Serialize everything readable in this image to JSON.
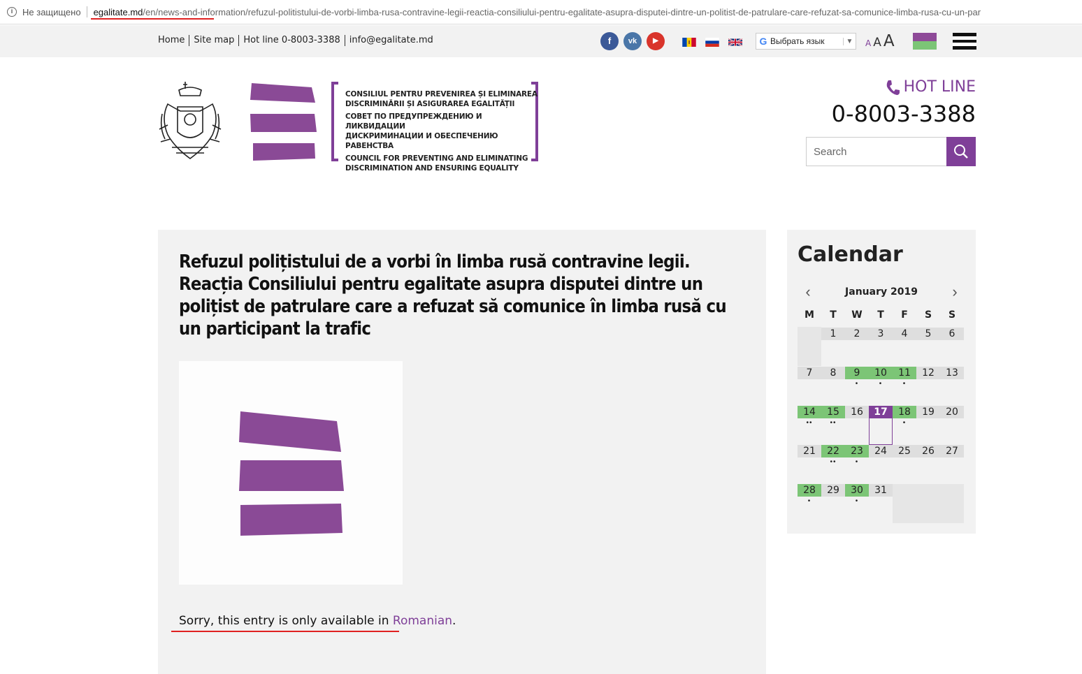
{
  "browser": {
    "security_label": "Не защищено",
    "url_host": "egalitate.md",
    "url_path": "/en/news-and-information/refuzul-politistului-de-vorbi-limba-rusa-contravine-legii-reactia-consiliului-pentru-egalitate-asupra-disputei-dintre-un-politist-de-patrulare-care-refuzat-sa-comunice-limba-rusa-cu-un-par"
  },
  "topbar": {
    "links": [
      "Home",
      "Site map",
      "Hot line 0-8003-3388",
      "info@egalitate.md"
    ],
    "social": [
      {
        "icon": "facebook-icon",
        "glyph": "f",
        "color": "#3b5998"
      },
      {
        "icon": "vk-icon",
        "glyph": "vk",
        "color": "#4a76a8"
      },
      {
        "icon": "youtube-icon",
        "glyph": "▶",
        "color": "#d9342b"
      }
    ],
    "translate_label": "Выбрать язык",
    "font_sizes": [
      "A",
      "A",
      "A"
    ]
  },
  "header": {
    "logo_lines": [
      "CONSILIUL PENTRU PREVENIREA ȘI ELIMINAREA",
      "DISCRIMINĂRII ȘI ASIGURAREA EGALITĂȚII",
      "СОВЕТ ПО ПРЕДУПРЕЖДЕНИЮ И ЛИКВИДАЦИИ",
      "ДИСКРИМИНАЦИИ И ОБЕСПЕЧЕНИЮ РАВЕНСТВА",
      "COUNCIL FOR PREVENTING AND ELIMINATING",
      "DISCRIMINATION AND ENSURING EQUALITY"
    ],
    "hotline_label": "HOT LINE",
    "hotline_number": "0-8003-3388",
    "search_placeholder": "Search"
  },
  "article": {
    "title": "Refuzul polițistului de a vorbi în limba rusă contravine legii. Reacția Consiliului pentru egalitate asupra disputei dintre un polițist de patrulare care a refuzat să comunice în limba rusă cu un participant la trafic",
    "notice_prefix": "Sorry, this entry is only available in ",
    "notice_link": "Romanian",
    "notice_suffix": "."
  },
  "calendar": {
    "title": "Calendar",
    "month": "January 2019",
    "weekdays": [
      "M",
      "T",
      "W",
      "T",
      "F",
      "S",
      "S"
    ],
    "first_weekday_index": 1,
    "days_in_month": 31,
    "event_days": {
      "9": 1,
      "10": 1,
      "11": 1,
      "14": 2,
      "15": 2,
      "18": 1,
      "22": 2,
      "23": 1,
      "28": 1,
      "30": 1
    },
    "today": 17
  },
  "colors": {
    "accent": "#7f3f98",
    "event": "#7cc576"
  }
}
